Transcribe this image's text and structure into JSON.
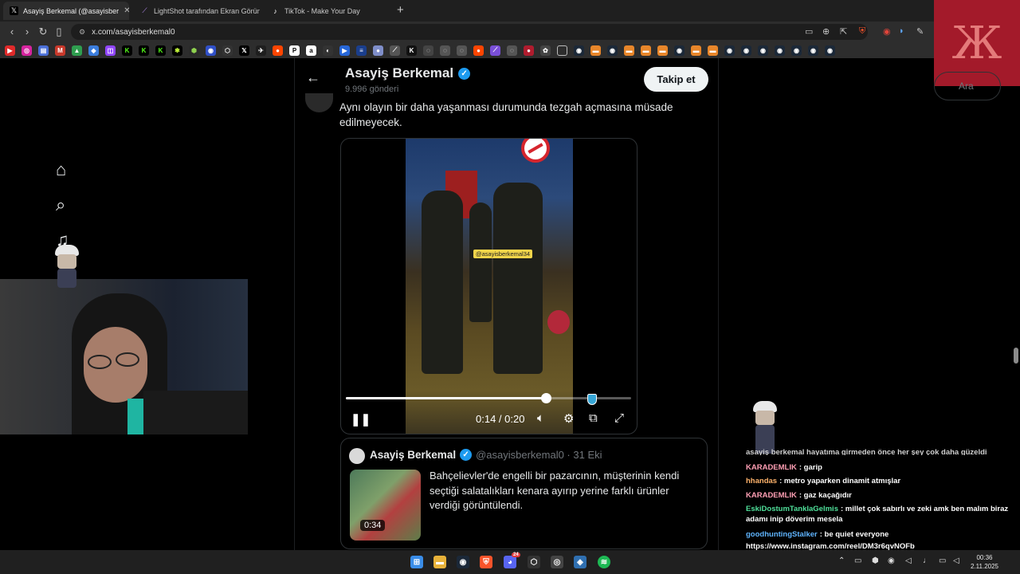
{
  "browser": {
    "tabs": [
      {
        "label": "Asayiş Berkemal (@asayisber",
        "icon": "x-logo-icon",
        "active": true
      },
      {
        "label": "LightShot tarafından Ekran Görüntüs",
        "icon": "feather-icon",
        "active": false
      },
      {
        "label": "TikTok - Make Your Day",
        "icon": "tiktok-icon",
        "active": false
      }
    ],
    "new_tab": "+",
    "url": "x.com/asayisberkemal0"
  },
  "profile_header": {
    "name": "Asayiş Berkemal",
    "posts": "9.996 gönderi",
    "follow_label": "Takip et"
  },
  "tweet": {
    "text": "Aynı olayın bir daha yaşanması durumunda tezgah açmasına müsade edilmeyecek.",
    "video": {
      "watermark": "@asayisberkemal34",
      "time": "0:14 / 0:20",
      "progress": 0.7
    }
  },
  "quoted_tweet": {
    "name": "Asayiş Berkemal",
    "handle": "@asayisberkemal0 · 31 Eki",
    "text": "Bahçelievler'de engelli bir pazarcının, müşterinin kendi seçtiği salatalıkları kenara ayırıp yerine farklı ürünler verdiği görüntülendi.",
    "duration": "0:34"
  },
  "search": {
    "placeholder": "Ara"
  },
  "chat": [
    {
      "user": "KARADEMLIK",
      "color": "#ff9fb4",
      "message": "garip"
    },
    {
      "user": "hhandas",
      "color": "#ffb36b",
      "message": "metro yaparken dinamit atmışlar"
    },
    {
      "user": "KARADEMLIK",
      "color": "#ff9fb4",
      "message": "gaz kaçağıdır"
    },
    {
      "user": "EskiDostumTanklaGelmis",
      "color": "#4fe09a",
      "message": "millet çok sabırlı ve zeki amk ben malım biraz adamı inip döverim mesela"
    },
    {
      "user": "goodhuntingStalker",
      "color": "#5fb4ff",
      "message": "be quiet everyone"
    },
    {
      "user": "",
      "color": "#ffffff",
      "message": "https://www.instagram.com/reel/DM3r6qvNOFb"
    }
  ],
  "chat_partial": "asayiş berkemal hayatıma girmeden önce her şey çok daha güzeldi",
  "taskbar": {
    "time": "00:36",
    "date": "2.11.2025",
    "discord_badge": "24"
  }
}
